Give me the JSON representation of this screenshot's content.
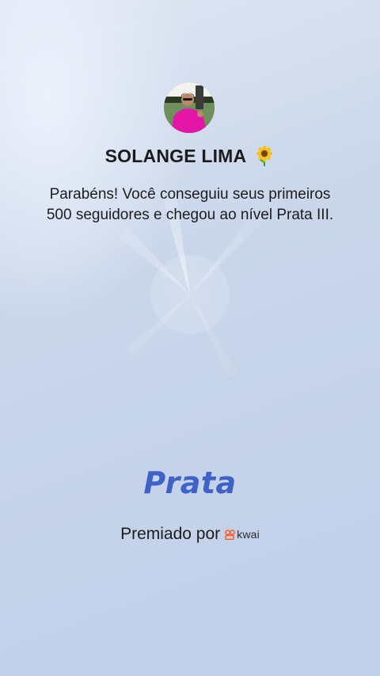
{
  "profile": {
    "name": "SOLANGE LIMA",
    "name_emoji_icon": "sunflower-icon",
    "avatar_icon": "profile-photo"
  },
  "message": "Parabéns! Você conseguiu seus primeiros 500 seguidores e chegou ao nível Prata III.",
  "level": {
    "title": "Prata",
    "color": "#3f62c8"
  },
  "awarded": {
    "label": "Premiado por",
    "brand": "kwai",
    "brand_icon": "kwai-logo-icon",
    "brand_color": "#ff5a1f"
  }
}
